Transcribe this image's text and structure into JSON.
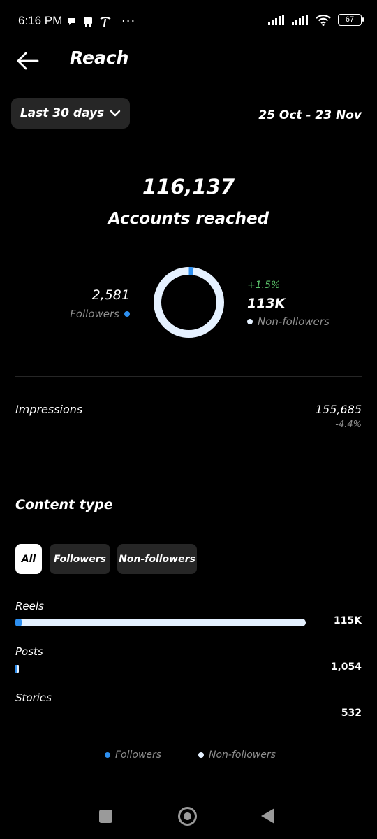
{
  "status_bar": {
    "time": "6:16 PM",
    "battery": "67",
    "icons": [
      "message-icon",
      "notification-icon",
      "carrier-icon",
      "more-dots-icon",
      "signal-icon",
      "signal-icon",
      "wifi-icon",
      "battery-icon"
    ],
    "dots": "···"
  },
  "header": {
    "title": "Reach"
  },
  "filter": {
    "range_label": "Last 30 days",
    "date_range": "25 Oct - 23 Nov"
  },
  "summary": {
    "accounts_reached_value": "116,137",
    "accounts_reached_label": "Accounts reached",
    "followers_value": "2,581",
    "followers_label": "Followers",
    "non_followers_change": "+1.5%",
    "non_followers_value": "113K",
    "non_followers_label": "Non-followers",
    "followers_fraction": 0.022
  },
  "impressions": {
    "label": "Impressions",
    "value": "155,685",
    "change": "-4.4%"
  },
  "content_type": {
    "title": "Content type",
    "tabs": [
      {
        "label": "All",
        "active": true
      },
      {
        "label": "Followers",
        "active": false
      },
      {
        "label": "Non-followers",
        "active": false
      }
    ],
    "rows": [
      {
        "label": "Reels",
        "value": "115K",
        "total_fraction": 1.0,
        "followers_fraction": 0.022
      },
      {
        "label": "Posts",
        "value": "1,054",
        "total_fraction": 0.009,
        "followers_fraction": 0.5
      },
      {
        "label": "Stories",
        "value": "532",
        "total_fraction": 0.0,
        "followers_fraction": 0.0
      }
    ]
  },
  "legend": {
    "followers": "Followers",
    "non_followers": "Non-followers"
  },
  "colors": {
    "followers": "#2d8ff0",
    "non_followers": "#e5f1ff",
    "positive": "#5bc26a",
    "chip_bg": "#262626"
  }
}
